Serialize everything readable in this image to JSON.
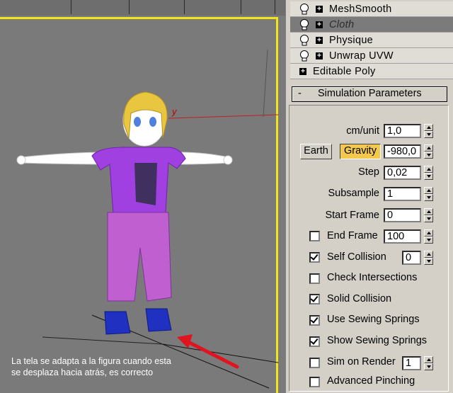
{
  "viewport": {
    "axis_label": "y",
    "caption": "La tela se adapta a la figura cuando esta\nse desplaza hacia atrás, es correcto",
    "colors": {
      "frame": "#f2e41a",
      "arrow": "#e0141e",
      "mesh_shirt": "#a040e0",
      "mesh_pants": "#c060d0",
      "mesh_shoes": "#2030c0",
      "hair": "#e8c640"
    }
  },
  "modifier_stack": {
    "items": [
      {
        "label": "MeshSmooth",
        "icon": "lightbulb-icon"
      },
      {
        "label": "Cloth",
        "icon": "lightbulb-icon"
      },
      {
        "label": "Physique",
        "icon": "lightbulb-icon"
      },
      {
        "label": "Unwrap UVW",
        "icon": "lightbulb-icon"
      },
      {
        "label": "Editable Poly",
        "icon": ""
      }
    ],
    "selected": "Cloth"
  },
  "rollout": {
    "title": "Simulation Parameters",
    "collapse_symbol": "-",
    "cm_unit": {
      "label": "cm/unit",
      "value": "1,0"
    },
    "earth_button": "Earth",
    "gravity_button": "Gravity",
    "gravity_value": "-980,0",
    "step": {
      "label": "Step",
      "value": "0,02"
    },
    "subsample": {
      "label": "Subsample",
      "value": "1"
    },
    "start_frame": {
      "label": "Start Frame",
      "value": "0"
    },
    "end_frame": {
      "label": "End Frame",
      "value": "100",
      "checked": false
    },
    "self_collision": {
      "label": "Self Collision",
      "value": "0",
      "checked": true
    },
    "check_intersections": {
      "label": "Check Intersections",
      "checked": false
    },
    "solid_collision": {
      "label": "Solid Collision",
      "checked": true
    },
    "use_sewing_springs": {
      "label": "Use Sewing Springs",
      "checked": true
    },
    "show_sewing_springs": {
      "label": "Show Sewing Springs",
      "checked": true
    },
    "sim_on_render": {
      "label": "Sim on Render",
      "value": "1",
      "checked": false
    },
    "advanced_pinching": {
      "label": "Advanced Pinching",
      "checked": false
    }
  }
}
